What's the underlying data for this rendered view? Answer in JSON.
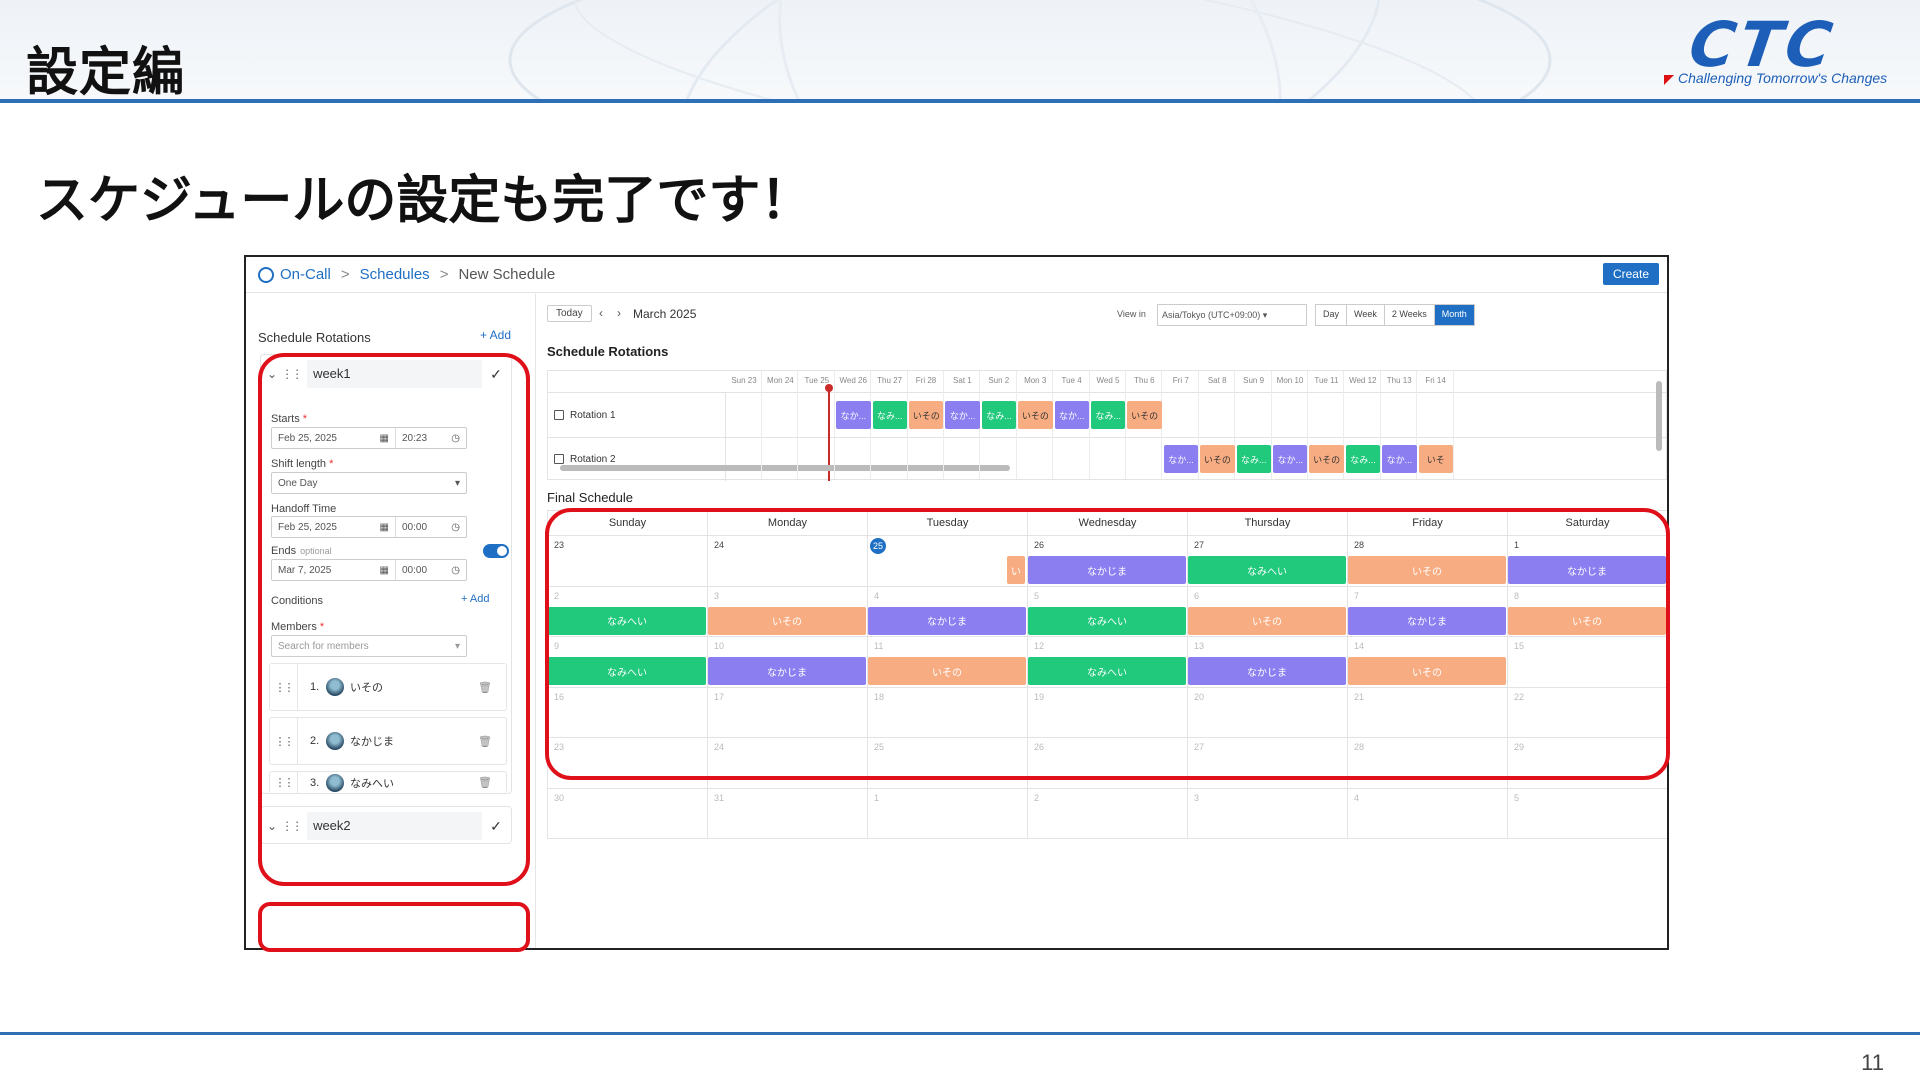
{
  "slide": {
    "title": "設定編",
    "subtitle": "スケジュールの設定も完了です！",
    "logo_text": "CTC",
    "logo_tagline": "Challenging Tomorrow's Changes",
    "page_number": "11"
  },
  "app": {
    "breadcrumb": [
      "On-Call",
      "Schedules",
      "New Schedule"
    ],
    "create_label": "Create",
    "left": {
      "title": "Schedule Rotations",
      "add_label": "+ Add",
      "rotation1_name": "week1",
      "rotation2_name": "week2",
      "starts_label": "Starts",
      "starts_date": "Feb 25, 2025",
      "starts_time": "20:23",
      "shift_label": "Shift length",
      "shift_value": "One Day",
      "handoff_label": "Handoff Time",
      "handoff_date": "Feb 25, 2025",
      "handoff_time": "00:00",
      "ends_label": "Ends",
      "ends_optional": "optional",
      "ends_date": "Mar 7, 2025",
      "ends_time": "00:00",
      "conditions_label": "Conditions",
      "conditions_add": "+ Add",
      "members_label": "Members",
      "members_placeholder": "Search for members",
      "members": [
        {
          "num": "1.",
          "name": "いその"
        },
        {
          "num": "2.",
          "name": "なかじま"
        },
        {
          "num": "3.",
          "name": "なみへい"
        }
      ]
    },
    "toolbar": {
      "today": "Today",
      "month": "March 2025",
      "view_in": "View in",
      "timezone": "Asia/Tokyo (UTC+09:00)",
      "views": [
        "Day",
        "Week",
        "2 Weeks",
        "Month"
      ],
      "active_view": "Month"
    },
    "timeline": {
      "title": "Schedule Rotations",
      "days": [
        "Sun 23",
        "Mon 24",
        "Tue 25",
        "Wed 26",
        "Thu 27",
        "Fri 28",
        "Sat 1",
        "Sun 2",
        "Mon 3",
        "Tue 4",
        "Wed 5",
        "Thu 6",
        "Fri 7",
        "Sat 8",
        "Sun 9",
        "Mon 10",
        "Tue 11",
        "Wed 12",
        "Thu 13",
        "Fri 14"
      ],
      "rows": [
        "Rotation 1",
        "Rotation 2"
      ],
      "rotation1": [
        {
          "day": 3,
          "label": "なか...",
          "c": "p"
        },
        {
          "day": 4,
          "label": "なみ...",
          "c": "g"
        },
        {
          "day": 5,
          "label": "いその",
          "c": "o"
        },
        {
          "day": 6,
          "label": "なか...",
          "c": "p"
        },
        {
          "day": 7,
          "label": "なみ...",
          "c": "g"
        },
        {
          "day": 8,
          "label": "いその",
          "c": "o"
        },
        {
          "day": 9,
          "label": "なか...",
          "c": "p"
        },
        {
          "day": 10,
          "label": "なみ...",
          "c": "g"
        },
        {
          "day": 11,
          "label": "いその",
          "c": "o"
        }
      ],
      "rotation2": [
        {
          "day": 12,
          "label": "なか...",
          "c": "p"
        },
        {
          "day": 13,
          "label": "いその",
          "c": "o"
        },
        {
          "day": 14,
          "label": "なみ...",
          "c": "g"
        },
        {
          "day": 15,
          "label": "なか...",
          "c": "p"
        },
        {
          "day": 16,
          "label": "いその",
          "c": "o"
        },
        {
          "day": 17,
          "label": "なみ...",
          "c": "g"
        },
        {
          "day": 18,
          "label": "なか...",
          "c": "p"
        },
        {
          "day": 19,
          "label": "いそ",
          "c": "o"
        }
      ]
    },
    "final": {
      "title": "Final Schedule",
      "weekdays": [
        "Sunday",
        "Monday",
        "Tuesday",
        "Wednesday",
        "Thursday",
        "Friday",
        "Saturday"
      ],
      "weeks": [
        [
          "23",
          "24",
          "25",
          "26",
          "27",
          "28",
          "1"
        ],
        [
          "2",
          "3",
          "4",
          "5",
          "6",
          "7",
          "8"
        ],
        [
          "9",
          "10",
          "11",
          "12",
          "13",
          "14",
          "15"
        ],
        [
          "16",
          "17",
          "18",
          "19",
          "20",
          "21",
          "22"
        ],
        [
          "23",
          "24",
          "25",
          "26",
          "27",
          "28",
          "29"
        ],
        [
          "30",
          "31",
          "1",
          "2",
          "3",
          "4",
          "5"
        ]
      ],
      "today_index": [
        0,
        2
      ],
      "events": [
        {
          "w": 0,
          "d": 2,
          "label": "い",
          "c": "o",
          "partial": true
        },
        {
          "w": 0,
          "d": 3,
          "label": "なかじま",
          "c": "p"
        },
        {
          "w": 0,
          "d": 4,
          "label": "なみへい",
          "c": "g"
        },
        {
          "w": 0,
          "d": 5,
          "label": "いその",
          "c": "o"
        },
        {
          "w": 0,
          "d": 6,
          "label": "なかじま",
          "c": "p"
        },
        {
          "w": 1,
          "d": 0,
          "label": "なみへい",
          "c": "g"
        },
        {
          "w": 1,
          "d": 1,
          "label": "いその",
          "c": "o"
        },
        {
          "w": 1,
          "d": 2,
          "label": "なかじま",
          "c": "p"
        },
        {
          "w": 1,
          "d": 3,
          "label": "なみへい",
          "c": "g"
        },
        {
          "w": 1,
          "d": 4,
          "label": "いその",
          "c": "o"
        },
        {
          "w": 1,
          "d": 5,
          "label": "なかじま",
          "c": "p"
        },
        {
          "w": 1,
          "d": 6,
          "label": "いその",
          "c": "o"
        },
        {
          "w": 2,
          "d": 0,
          "label": "なみへい",
          "c": "g"
        },
        {
          "w": 2,
          "d": 1,
          "label": "なかじま",
          "c": "p"
        },
        {
          "w": 2,
          "d": 2,
          "label": "いその",
          "c": "o"
        },
        {
          "w": 2,
          "d": 3,
          "label": "なみへい",
          "c": "g"
        },
        {
          "w": 2,
          "d": 4,
          "label": "なかじま",
          "c": "p"
        },
        {
          "w": 2,
          "d": 5,
          "label": "いその",
          "c": "o"
        }
      ]
    },
    "colors": {
      "p": "#8b7ef0",
      "g": "#21c97c",
      "o": "#f8ac82",
      "accent": "#1f6fc5",
      "highlight": "#e0101a"
    }
  }
}
